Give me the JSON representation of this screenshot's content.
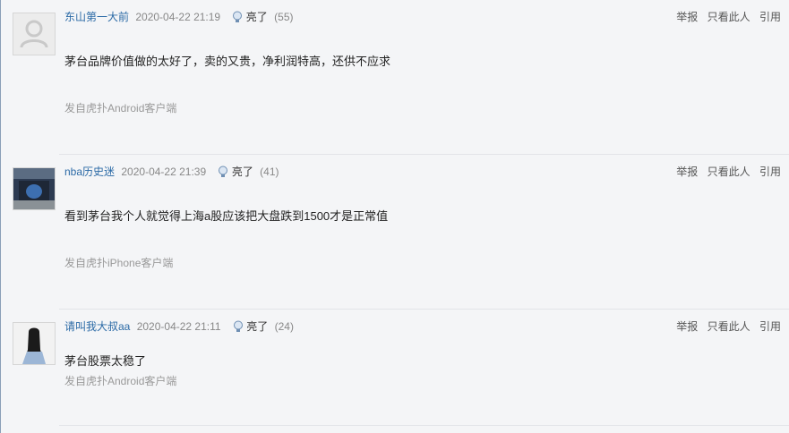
{
  "posts": [
    {
      "author": "东山第一大前",
      "time": "2020-04-22 21:19",
      "light_label": "亮了",
      "light_count": "(55)",
      "actions": [
        "举报",
        "只看此人",
        "引用"
      ],
      "content": "茅台品牌价值做的太好了，卖的又贵，净利润特高，还供不应求",
      "source": "发自虎扑Android客户端"
    },
    {
      "author": "nba历史迷",
      "time": "2020-04-22 21:39",
      "light_label": "亮了",
      "light_count": "(41)",
      "actions": [
        "举报",
        "只看此人",
        "引用"
      ],
      "content": "看到茅台我个人就觉得上海a股应该把大盘跌到1500才是正常值",
      "source": "发自虎扑iPhone客户端"
    },
    {
      "author": "请叫我大叔aa",
      "time": "2020-04-22 21:11",
      "light_label": "亮了",
      "light_count": "(24)",
      "actions": [
        "举报",
        "只看此人",
        "引用"
      ],
      "content": "茅台股票太稳了",
      "source": "发自虎扑Android客户端"
    }
  ],
  "colors": {
    "author_link": "#2b6aa6",
    "background": "#f4f5f7",
    "muted": "#999999"
  },
  "icons": [
    "default-avatar-icon",
    "lightbulb-icon"
  ]
}
